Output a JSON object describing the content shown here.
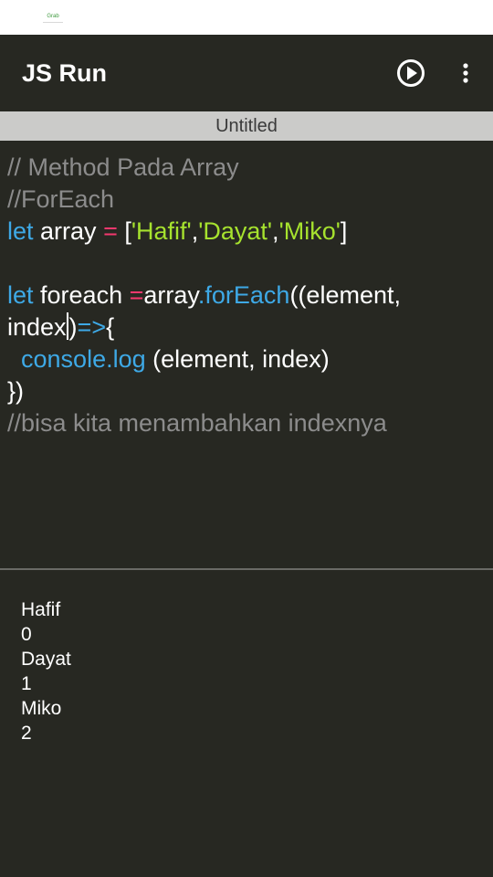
{
  "status_bar": {
    "logo_text": "Grab"
  },
  "app_bar": {
    "title": "JS Run",
    "run_icon": "play-circle-icon",
    "menu_icon": "more-vertical-icon"
  },
  "file_tab": {
    "name": "Untitled"
  },
  "colors": {
    "background": "#272822",
    "comment": "#8c8c8c",
    "keyword": "#3ea9e6",
    "operator": "#f4386e",
    "string": "#a6e22e",
    "tab": "#cbcbc9"
  },
  "editor": {
    "lines": [
      [
        {
          "t": "comment",
          "v": "// Method Pada Array"
        }
      ],
      [
        {
          "t": "comment",
          "v": "//ForEach"
        }
      ],
      [
        {
          "t": "keyword",
          "v": "let"
        },
        {
          "t": "plain",
          "v": " array "
        },
        {
          "t": "op",
          "v": "="
        },
        {
          "t": "plain",
          "v": " ["
        },
        {
          "t": "string",
          "v": "'Hafif'"
        },
        {
          "t": "plain",
          "v": ","
        },
        {
          "t": "string",
          "v": "'Dayat'"
        },
        {
          "t": "plain",
          "v": ","
        },
        {
          "t": "string",
          "v": "'Miko'"
        },
        {
          "t": "plain",
          "v": "]"
        }
      ],
      [],
      [
        {
          "t": "keyword",
          "v": "let"
        },
        {
          "t": "plain",
          "v": " foreach "
        },
        {
          "t": "op",
          "v": "="
        },
        {
          "t": "plain",
          "v": "array"
        },
        {
          "t": "func",
          "v": ".forEach"
        },
        {
          "t": "plain",
          "v": "((element,"
        }
      ],
      [
        {
          "t": "plain",
          "v": "index"
        },
        {
          "t": "caret",
          "v": ""
        },
        {
          "t": "plain",
          "v": ")"
        },
        {
          "t": "arrow",
          "v": "=>"
        },
        {
          "t": "plain",
          "v": "{"
        }
      ],
      [
        {
          "t": "plain",
          "v": "  "
        },
        {
          "t": "func",
          "v": "console.log"
        },
        {
          "t": "plain",
          "v": " (element, index)"
        }
      ],
      [
        {
          "t": "plain",
          "v": "})"
        }
      ],
      [
        {
          "t": "comment",
          "v": "//bisa kita menambahkan indexnya"
        }
      ]
    ]
  },
  "console": {
    "output": [
      "Hafif",
      "0",
      "Dayat",
      "1",
      "Miko",
      "2"
    ]
  }
}
